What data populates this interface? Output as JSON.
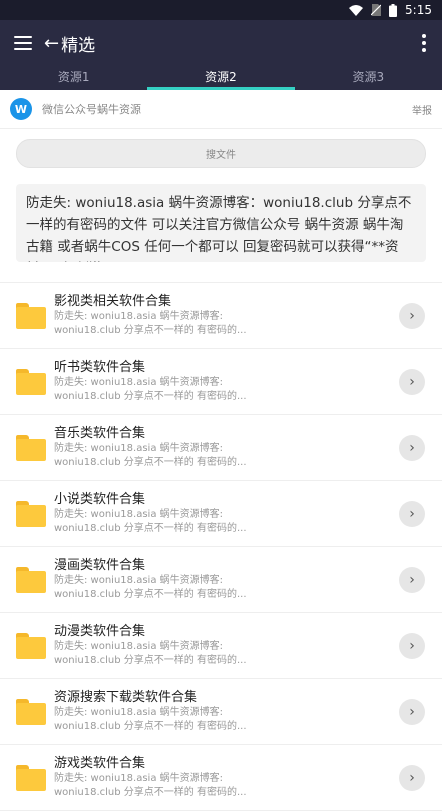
{
  "status": {
    "time": "5:15"
  },
  "appbar": {
    "back": "←",
    "title": "精选"
  },
  "tabs": [
    {
      "label": "资源1"
    },
    {
      "label": "资源2",
      "active": true
    },
    {
      "label": "资源3"
    }
  ],
  "source": {
    "logo_letter": "W",
    "name": "微信公众号蜗牛资源",
    "report": "举报"
  },
  "search": {
    "placeholder": "搜文件"
  },
  "notice": "防走失: woniu18.asia 蜗牛资源博客：woniu18.club 分享点不一样的有密码的文件 可以关注官方微信公众号 蜗牛资源 蜗牛淘古籍 或者蜗牛COS 任何一个都可以 回复密码就可以获得“**资料”~ 很刺激！！！",
  "items": [
    {
      "title": "影视类相关软件合集",
      "desc1": "防走失: woniu18.asia 蜗牛资源博客:",
      "desc2": "woniu18.club 分享点不一样的 有密码的..."
    },
    {
      "title": "听书类软件合集",
      "desc1": "防走失: woniu18.asia 蜗牛资源博客:",
      "desc2": "woniu18.club 分享点不一样的 有密码的..."
    },
    {
      "title": "音乐类软件合集",
      "desc1": "防走失: woniu18.asia 蜗牛资源博客:",
      "desc2": "woniu18.club 分享点不一样的 有密码的..."
    },
    {
      "title": "小说类软件合集",
      "desc1": "防走失: woniu18.asia 蜗牛资源博客:",
      "desc2": "woniu18.club 分享点不一样的 有密码的..."
    },
    {
      "title": "漫画类软件合集",
      "desc1": "防走失: woniu18.asia 蜗牛资源博客:",
      "desc2": "woniu18.club 分享点不一样的 有密码的..."
    },
    {
      "title": "动漫类软件合集",
      "desc1": "防走失: woniu18.asia 蜗牛资源博客:",
      "desc2": "woniu18.club 分享点不一样的 有密码的..."
    },
    {
      "title": "资源搜索下载类软件合集",
      "desc1": "防走失: woniu18.asia 蜗牛资源博客:",
      "desc2": "woniu18.club 分享点不一样的 有密码的..."
    },
    {
      "title": "游戏类软件合集",
      "desc1": "防走失: woniu18.asia 蜗牛资源博客:",
      "desc2": "woniu18.club 分享点不一样的 有密码的..."
    }
  ]
}
